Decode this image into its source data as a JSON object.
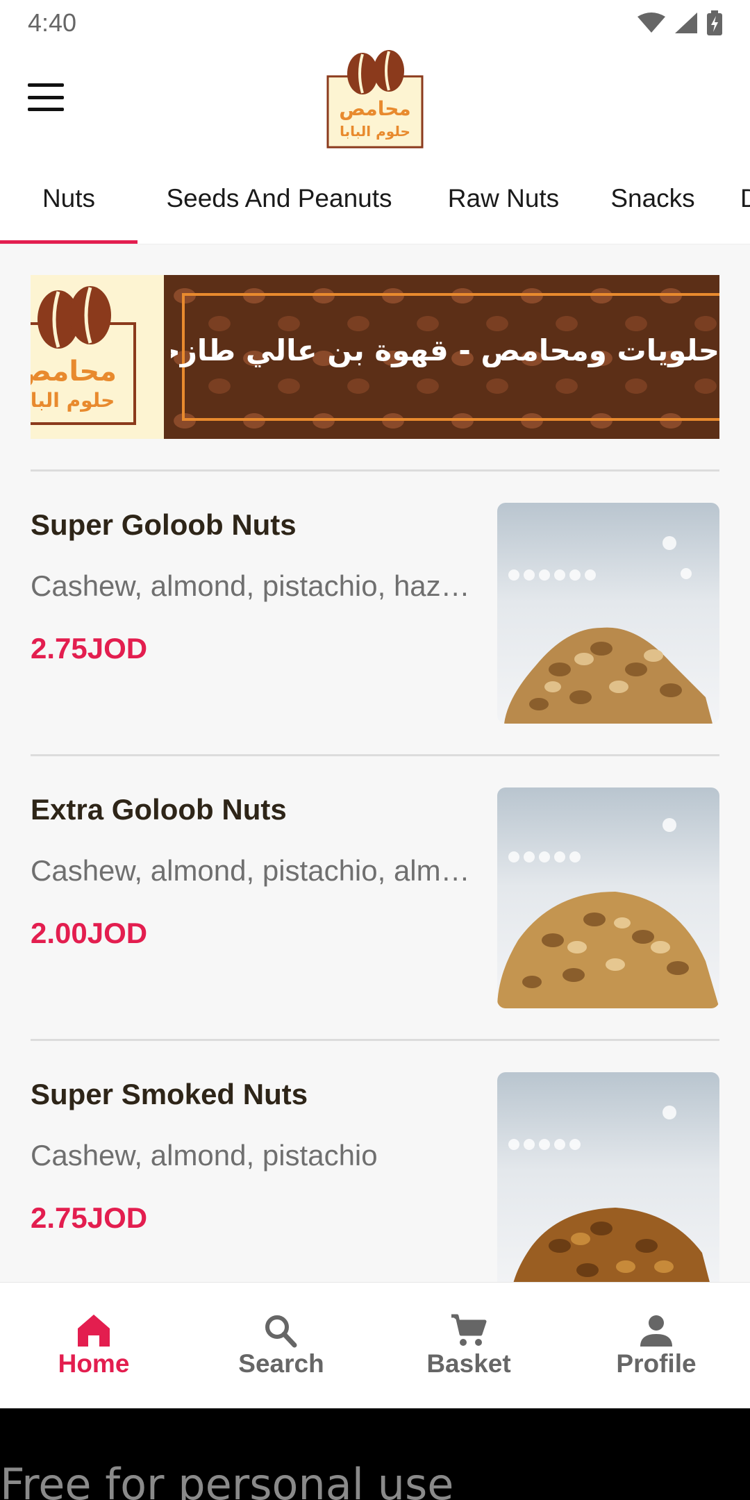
{
  "status_bar": {
    "time": "4:40"
  },
  "header": {
    "logo_text_top": "محامص",
    "logo_text_bottom": "حلوم البابا"
  },
  "tabs": [
    {
      "label": "Nuts",
      "active": true
    },
    {
      "label": "Seeds And Peanuts",
      "active": false
    },
    {
      "label": "Raw Nuts",
      "active": false
    },
    {
      "label": "Snacks",
      "active": false
    },
    {
      "label": "D",
      "active": false
    }
  ],
  "banner": {
    "text": "حلويات ومحامص - قهوة بن عالي طازجة - مكسرات - سكاكر - بهارات - تمور",
    "logo_text_top": "محامص",
    "logo_text_bottom": "حلوم البابا"
  },
  "products": [
    {
      "name": "Super Goloob Nuts",
      "description": "Cashew, almond, pistachio, hazelnut",
      "price": "2.75JOD"
    },
    {
      "name": "Extra Goloob Nuts",
      "description": "Cashew, almond, pistachio, almond",
      "price": "2.00JOD"
    },
    {
      "name": "Super Smoked Nuts",
      "description": "Cashew, almond, pistachio",
      "price": "2.75JOD"
    }
  ],
  "bottom_nav": [
    {
      "label": "Home",
      "icon": "home-icon",
      "active": true
    },
    {
      "label": "Search",
      "icon": "search-icon",
      "active": false
    },
    {
      "label": "Basket",
      "icon": "cart-icon",
      "active": false
    },
    {
      "label": "Profile",
      "icon": "person-icon",
      "active": false
    }
  ],
  "watermark": "Free for personal use",
  "colors": {
    "accent": "#e31e4f",
    "brand_brown": "#8b3a1c",
    "brand_orange": "#e88a2e"
  }
}
